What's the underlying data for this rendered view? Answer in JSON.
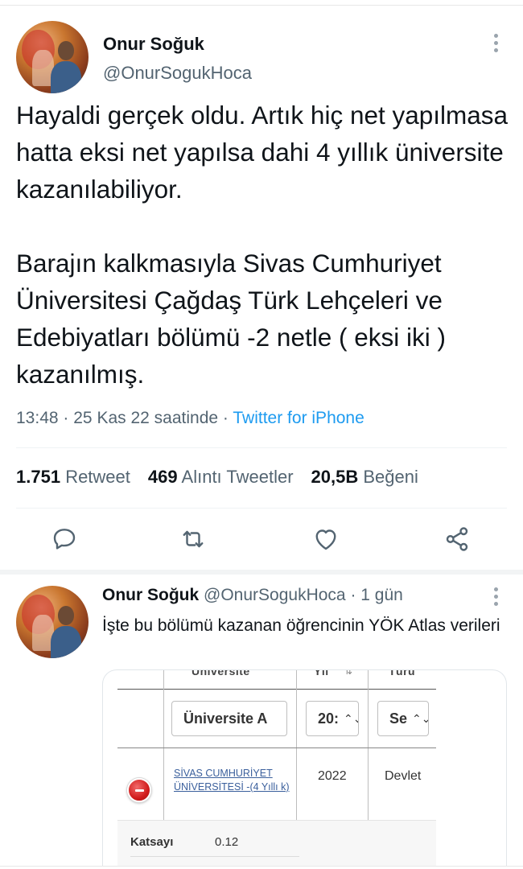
{
  "tweet": {
    "author_name": "Onur Soğuk",
    "author_handle": "@OnurSogukHoca",
    "text": "Hayaldi gerçek oldu. Artık hiç net yapılmasa hatta eksi net yapılsa dahi 4 yıllık üniversite kazanılabiliyor.\n\nBarajın kalkmasıyla Sivas Cumhuriyet Üniversitesi Çağdaş Türk Lehçeleri ve Edebiyatları bölümü -2 netle ( eksi iki ) kazanılmış.",
    "time": "13:48",
    "date": "25 Kas 22 saatinde",
    "separator": "·",
    "source": "Twitter for iPhone",
    "stats": [
      {
        "value": "1.751",
        "label": "Retweet"
      },
      {
        "value": "469",
        "label": "Alıntı Tweetler"
      },
      {
        "value": "20,5B",
        "label": "Beğeni"
      }
    ],
    "actions": [
      "reply-icon",
      "retweet-icon",
      "like-icon",
      "share-icon"
    ]
  },
  "reply": {
    "author_name": "Onur Soğuk",
    "author_handle": "@OnurSogukHoca",
    "separator": "·",
    "time_ago": "1 gün",
    "text": "İşte bu bölümü kazanan öğrencinin YÖK Atlas verileri",
    "embedded_image": {
      "header_cut": [
        "Üniversite",
        "Yıl",
        "Türü"
      ],
      "filters": [
        {
          "value": "Üniversite A"
        },
        {
          "value": "20:"
        },
        {
          "value": "Se"
        }
      ],
      "row": {
        "university": "SİVAS CUMHURİYET ÜNİVERSİTESİ -(4 Yıllı k)",
        "year": "2022",
        "type": "Devlet"
      },
      "katsayi_label": "Katsayı",
      "katsayi_value": "0.12"
    }
  },
  "colors": {
    "text": "#0f1419",
    "secondary": "#536471",
    "link": "#1d9bf0",
    "embed_link": "#3a5f9c",
    "status_red": "#d11c1c"
  }
}
